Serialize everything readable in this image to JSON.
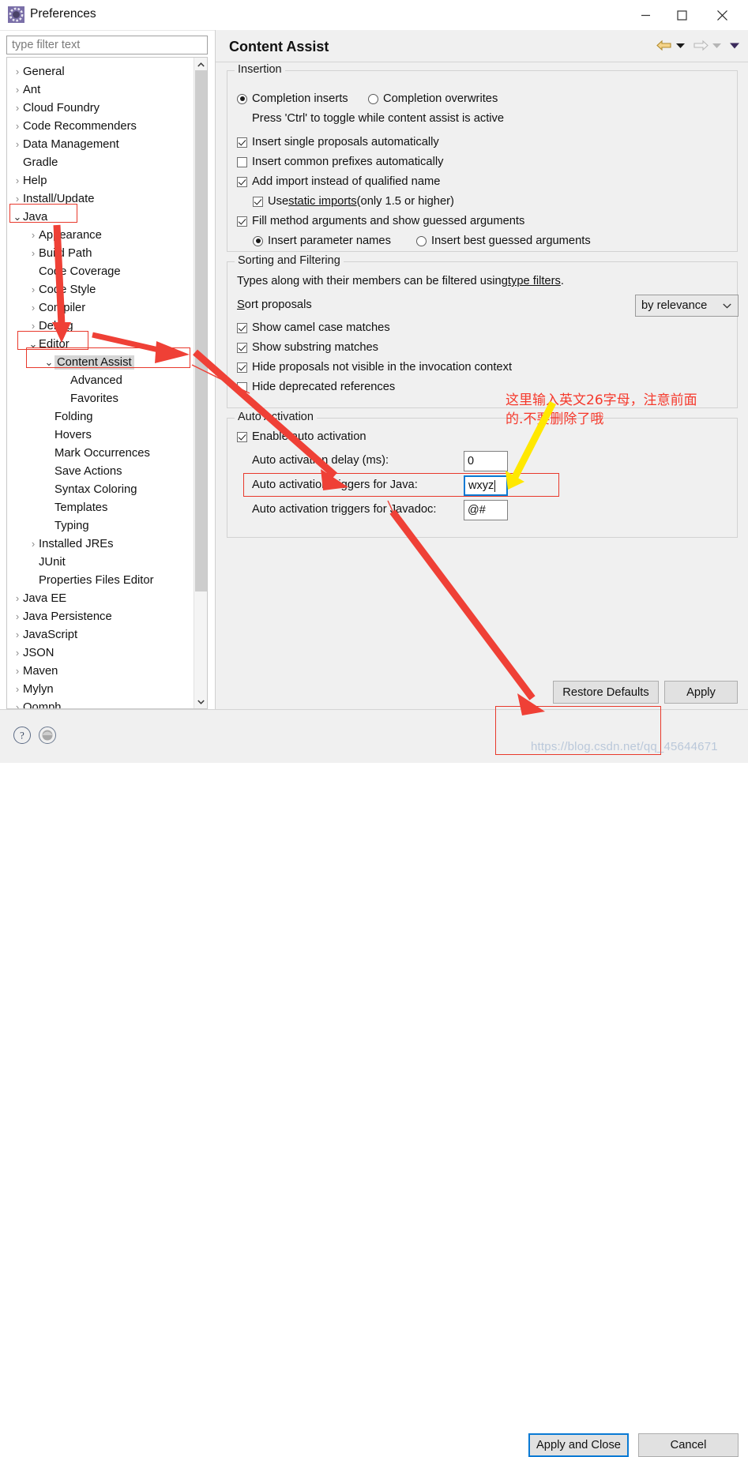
{
  "window": {
    "title": "Preferences",
    "icon": "preferences-gear-icon",
    "controls": {
      "minimize": "–",
      "maximize": "□",
      "close": "✕"
    }
  },
  "filter": {
    "placeholder": "type filter text",
    "value": ""
  },
  "tree": {
    "items": [
      {
        "label": "General",
        "indent": 0,
        "twisty": "collapsed",
        "selected": false
      },
      {
        "label": "Ant",
        "indent": 0,
        "twisty": "collapsed",
        "selected": false
      },
      {
        "label": "Cloud Foundry",
        "indent": 0,
        "twisty": "collapsed",
        "selected": false
      },
      {
        "label": "Code Recommenders",
        "indent": 0,
        "twisty": "collapsed",
        "selected": false
      },
      {
        "label": "Data Management",
        "indent": 0,
        "twisty": "collapsed",
        "selected": false
      },
      {
        "label": "Gradle",
        "indent": 0,
        "twisty": "none",
        "selected": false
      },
      {
        "label": "Help",
        "indent": 0,
        "twisty": "collapsed",
        "selected": false
      },
      {
        "label": "Install/Update",
        "indent": 0,
        "twisty": "collapsed",
        "selected": false
      },
      {
        "label": "Java",
        "indent": 0,
        "twisty": "expanded",
        "selected": false
      },
      {
        "label": "Appearance",
        "indent": 1,
        "twisty": "collapsed",
        "selected": false
      },
      {
        "label": "Build Path",
        "indent": 1,
        "twisty": "collapsed",
        "selected": false
      },
      {
        "label": "Code Coverage",
        "indent": 1,
        "twisty": "none",
        "selected": false
      },
      {
        "label": "Code Style",
        "indent": 1,
        "twisty": "collapsed",
        "selected": false
      },
      {
        "label": "Compiler",
        "indent": 1,
        "twisty": "collapsed",
        "selected": false
      },
      {
        "label": "Debug",
        "indent": 1,
        "twisty": "collapsed",
        "selected": false
      },
      {
        "label": "Editor",
        "indent": 1,
        "twisty": "expanded",
        "selected": false
      },
      {
        "label": "Content Assist",
        "indent": 2,
        "twisty": "expanded",
        "selected": true
      },
      {
        "label": "Advanced",
        "indent": 3,
        "twisty": "none",
        "selected": false
      },
      {
        "label": "Favorites",
        "indent": 3,
        "twisty": "none",
        "selected": false
      },
      {
        "label": "Folding",
        "indent": 2,
        "twisty": "none",
        "selected": false
      },
      {
        "label": "Hovers",
        "indent": 2,
        "twisty": "none",
        "selected": false
      },
      {
        "label": "Mark Occurrences",
        "indent": 2,
        "twisty": "none",
        "selected": false
      },
      {
        "label": "Save Actions",
        "indent": 2,
        "twisty": "none",
        "selected": false
      },
      {
        "label": "Syntax Coloring",
        "indent": 2,
        "twisty": "none",
        "selected": false
      },
      {
        "label": "Templates",
        "indent": 2,
        "twisty": "none",
        "selected": false
      },
      {
        "label": "Typing",
        "indent": 2,
        "twisty": "none",
        "selected": false
      },
      {
        "label": "Installed JREs",
        "indent": 1,
        "twisty": "collapsed",
        "selected": false
      },
      {
        "label": "JUnit",
        "indent": 1,
        "twisty": "none",
        "selected": false
      },
      {
        "label": "Properties Files Editor",
        "indent": 1,
        "twisty": "none",
        "selected": false
      },
      {
        "label": "Java EE",
        "indent": 0,
        "twisty": "collapsed",
        "selected": false
      },
      {
        "label": "Java Persistence",
        "indent": 0,
        "twisty": "collapsed",
        "selected": false
      },
      {
        "label": "JavaScript",
        "indent": 0,
        "twisty": "collapsed",
        "selected": false
      },
      {
        "label": "JSON",
        "indent": 0,
        "twisty": "collapsed",
        "selected": false
      },
      {
        "label": "Maven",
        "indent": 0,
        "twisty": "collapsed",
        "selected": false
      },
      {
        "label": "Mylyn",
        "indent": 0,
        "twisty": "collapsed",
        "selected": false
      },
      {
        "label": "Oomph",
        "indent": 0,
        "twisty": "collapsed",
        "selected": false
      }
    ]
  },
  "page": {
    "title": "Content Assist",
    "nav": {
      "back": "back-arrow",
      "back_menu": "chevron-down",
      "forward": "forward-arrow",
      "forward_menu": "chevron-down",
      "view_menu": "chevron-down"
    },
    "insertion": {
      "legend": "Insertion",
      "radio_inserts": "Completion inserts",
      "radio_overwrites": "Completion overwrites",
      "hint": "Press 'Ctrl' to toggle while content assist is active",
      "cb_single": "Insert single proposals automatically",
      "cb_prefixes": "Insert common prefixes automatically",
      "cb_import": "Add import instead of qualified name",
      "cb_static_pre": "Use ",
      "cb_static_link": "static imports",
      "cb_static_post": " (only 1.5 or higher)",
      "cb_fill": "Fill method arguments and show guessed arguments",
      "radio_param_names": "Insert parameter names",
      "radio_best_guessed": "Insert best guessed arguments"
    },
    "sorting": {
      "legend": "Sorting and Filtering",
      "desc_pre": "Types along with their members can be filtered using ",
      "desc_link": "type filters",
      "desc_post": ".",
      "sort_label": "Sort proposals",
      "sort_value": "by relevance",
      "cb_camel": "Show camel case matches",
      "cb_substring": "Show substring matches",
      "cb_hide_invocation": "Hide proposals not visible in the invocation context",
      "cb_hide_deprecated": "Hide deprecated references"
    },
    "auto_activation": {
      "legend": "Auto Activation",
      "cb_enable": "Enable auto activation",
      "delay_label": "Auto activation delay (ms):",
      "delay_value": "0",
      "java_label": "Auto activation triggers for Java:",
      "java_value": "wxyz",
      "javadoc_label": "Auto activation triggers for Javadoc:",
      "javadoc_value": "@#"
    },
    "buttons": {
      "restore_defaults": "Restore Defaults",
      "apply": "Apply"
    }
  },
  "footer": {
    "help_icon": "question-mark-icon",
    "secondary_icon": "circle-icon",
    "apply_and_close": "Apply and Close",
    "cancel": "Cancel"
  },
  "annotations": {
    "chinese_note": "这里输入英文26字母，注意前面\n的.不要删除了哦",
    "watermark": "https://blog.csdn.net/qq_45644671",
    "red": "#e8392c",
    "yellow": "#ffe800"
  }
}
